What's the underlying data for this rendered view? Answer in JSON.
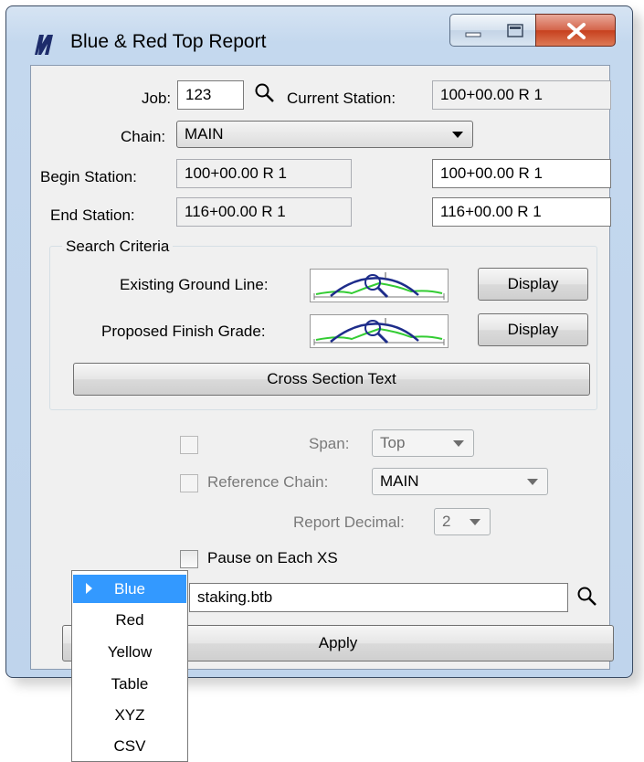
{
  "window": {
    "title": "Blue & Red Top Report"
  },
  "form": {
    "job_label": "Job:",
    "job_value": "123",
    "current_station_label": "Current Station:",
    "current_station_value": "100+00.00 R 1",
    "chain_label": "Chain:",
    "chain_value": "MAIN",
    "begin_station_label": "Begin Station:",
    "begin_station_ro": "100+00.00 R 1",
    "begin_station_value": "100+00.00 R 1",
    "end_station_label": "End Station:",
    "end_station_ro": "116+00.00 R 1",
    "end_station_value": "116+00.00 R 1"
  },
  "search_criteria": {
    "group_label": "Search Criteria",
    "existing_ground_label": "Existing Ground Line:",
    "proposed_finish_label": "Proposed Finish Grade:",
    "display_label": "Display",
    "cross_section_label": "Cross Section Text"
  },
  "options": {
    "span_label": "Span:",
    "span_value": "Top",
    "reference_chain_label": "Reference Chain:",
    "reference_chain_value": "MAIN",
    "report_decimal_label": "Report Decimal:",
    "report_decimal_value": "2",
    "pause_label": "Pause on Each XS"
  },
  "output": {
    "file_value": "staking.btb",
    "apply_label": "Apply"
  },
  "format_menu": {
    "items": [
      "Blue",
      "Red",
      "Yellow",
      "Table",
      "XYZ",
      "CSV"
    ],
    "selected": "Blue"
  },
  "colors": {
    "selection": "#3399ff",
    "title_gradient": "#c4d8ee",
    "close_button": "#c7401e"
  }
}
